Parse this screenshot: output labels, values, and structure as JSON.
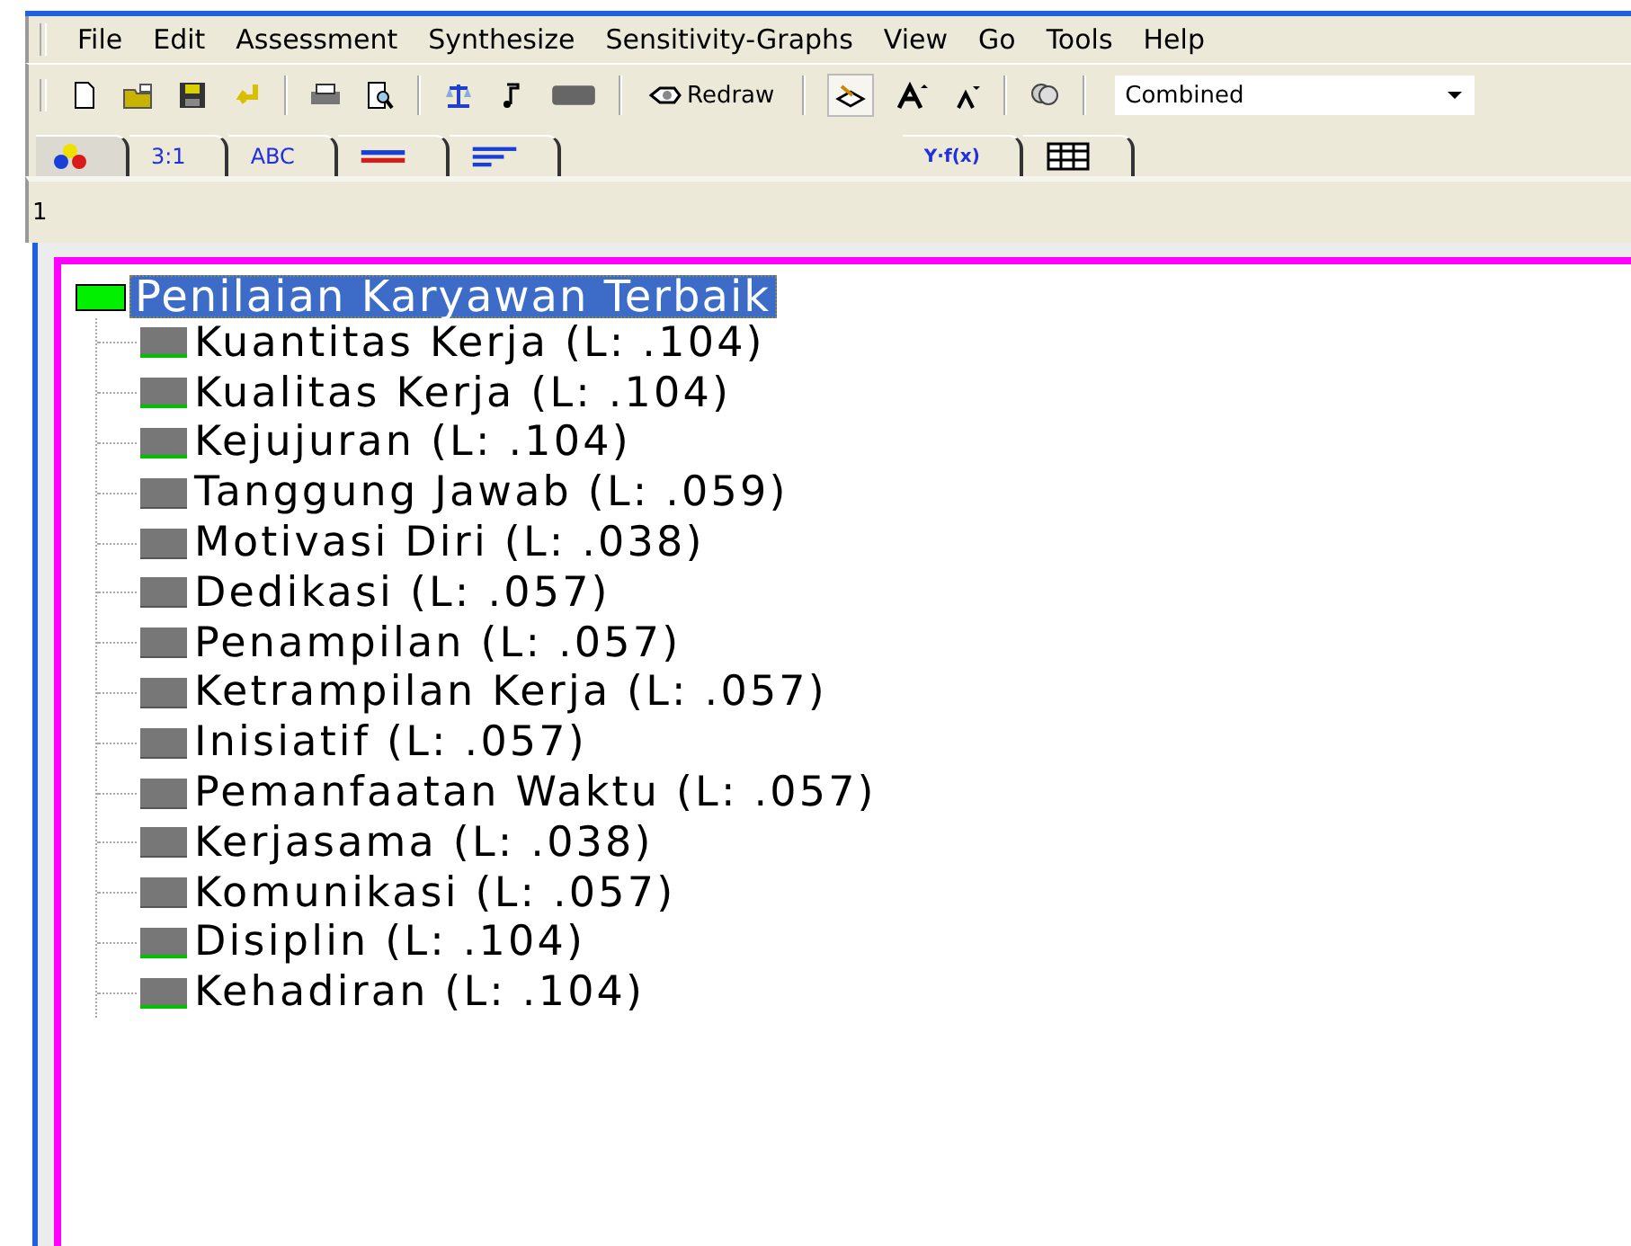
{
  "menu": [
    {
      "label": "File"
    },
    {
      "label": "Edit"
    },
    {
      "label": "Assessment"
    },
    {
      "label": "Synthesize"
    },
    {
      "label": "Sensitivity-Graphs"
    },
    {
      "label": "View"
    },
    {
      "label": "Go"
    },
    {
      "label": "Tools"
    },
    {
      "label": "Help"
    }
  ],
  "toolbar": {
    "redraw": {
      "label": "Redraw"
    },
    "view_select": {
      "value": "Combined"
    },
    "pressed_pen": true
  },
  "tabs": [
    {
      "kind": "icon-colors",
      "selected": true
    },
    {
      "kind": "text",
      "label": "3:1",
      "selected": false
    },
    {
      "kind": "text",
      "label": "ABC",
      "selected": false
    },
    {
      "kind": "icon-lines",
      "selected": false
    },
    {
      "kind": "icon-bars",
      "selected": false
    },
    {
      "kind": "gap"
    },
    {
      "kind": "formula",
      "label": "Y·f(x)",
      "selected": false
    },
    {
      "kind": "icon-grid",
      "selected": false
    }
  ],
  "edit_line": "1",
  "tree": {
    "label": "Penilaian Karyawan Terbaik",
    "selected": true,
    "children": [
      {
        "label": "Kuantitas Kerja (L: .104)",
        "green_bar": true
      },
      {
        "label": "Kualitas Kerja (L: .104)",
        "green_bar": true
      },
      {
        "label": "Kejujuran (L: .104)",
        "green_bar": true
      },
      {
        "label": "Tanggung Jawab (L: .059)",
        "green_bar": false
      },
      {
        "label": "Motivasi Diri (L: .038)",
        "green_bar": false
      },
      {
        "label": "Dedikasi (L: .057)",
        "green_bar": false
      },
      {
        "label": "Penampilan (L: .057)",
        "green_bar": false
      },
      {
        "label": "Ketrampilan Kerja (L: .057)",
        "green_bar": false
      },
      {
        "label": "Inisiatif (L: .057)",
        "green_bar": false
      },
      {
        "label": "Pemanfaatan Waktu (L: .057)",
        "green_bar": false
      },
      {
        "label": "Kerjasama (L: .038)",
        "green_bar": false
      },
      {
        "label": "Komunikasi (L: .057)",
        "green_bar": false
      },
      {
        "label": "Disiplin (L: .104)",
        "green_bar": true
      },
      {
        "label": "Kehadiran (L: .104)",
        "green_bar": true
      }
    ]
  }
}
